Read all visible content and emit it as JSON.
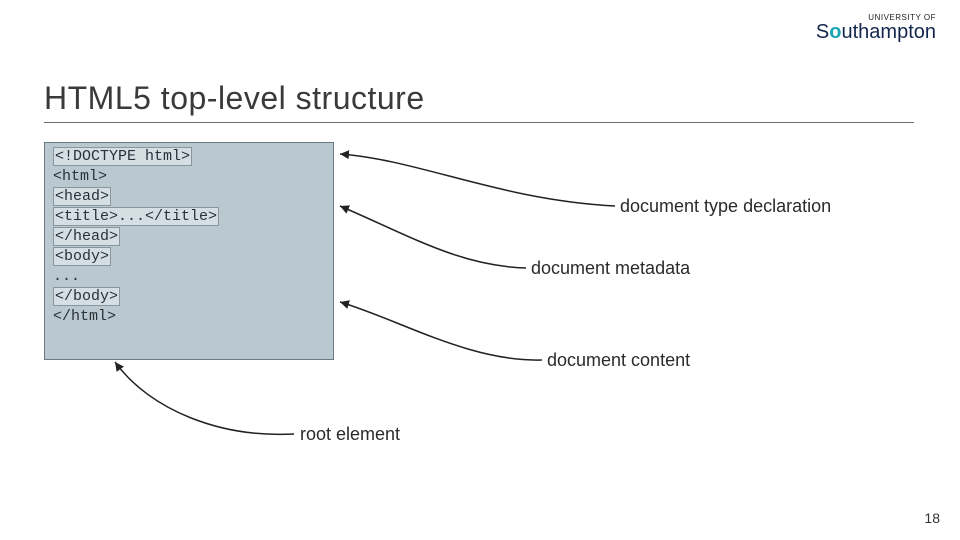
{
  "logo": {
    "topline": "UNIVERSITY OF",
    "main_pre": "S",
    "main_accent_letter": "o",
    "main_rest": "uthampton"
  },
  "title": "HTML5 top-level structure",
  "code": {
    "l1": "<!DOCTYPE html>",
    "l2": "<html>",
    "l3a": "  ",
    "l3b": "<head>",
    "l4a": "    ",
    "l4b": "<title>...</title>",
    "l5a": "  ",
    "l5b": "</head>",
    "l6a": "  ",
    "l6b": "<body>",
    "l7": " ",
    "l8": "  ...",
    "l9": " ",
    "l10a": "  ",
    "l10b": "</body>",
    "l11": "</html>"
  },
  "labels": {
    "doctype": "document type declaration",
    "metadata": "document metadata",
    "content": "document content",
    "root": "root element"
  },
  "pageno": "18"
}
